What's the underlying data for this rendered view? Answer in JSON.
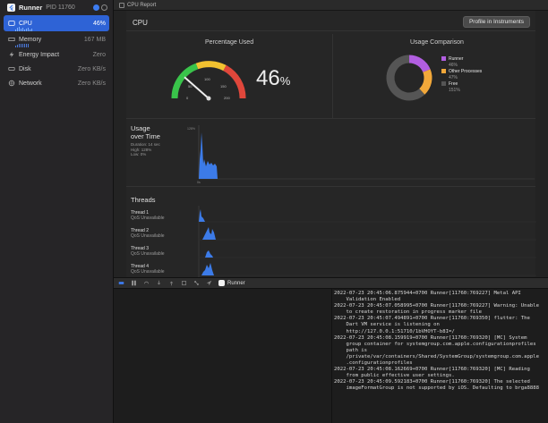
{
  "sidebar": {
    "app_name": "Runner",
    "pid": "PID 11760",
    "gauges": [
      {
        "label": "CPU",
        "value": "46%",
        "icon": "cpu-gauge-icon",
        "selected": true
      },
      {
        "label": "Memory",
        "value": "167 MB",
        "icon": "memory-gauge-icon"
      },
      {
        "label": "Energy Impact",
        "value": "Zero",
        "icon": "energy-icon"
      },
      {
        "label": "Disk",
        "value": "Zero KB/s",
        "icon": "disk-icon"
      },
      {
        "label": "Network",
        "value": "Zero KB/s",
        "icon": "network-icon"
      }
    ]
  },
  "main": {
    "window_title": "CPU Report",
    "cpu_label": "CPU",
    "profile_button": "Profile in Instruments",
    "percentage_used": {
      "title": "Percentage Used",
      "value": "46",
      "unit": "%",
      "gauge_ticks": [
        "0",
        "50",
        "100",
        "150",
        "200"
      ],
      "gauge_needle": 0.23
    },
    "usage_comparison": {
      "title": "Usage Comparison",
      "legend": [
        {
          "name": "Runner",
          "value": "46%",
          "color": "#b15ee0"
        },
        {
          "name": "Other Processes",
          "value": "47%",
          "color": "#f2a83a"
        },
        {
          "name": "Free",
          "value": "151%",
          "color": "#555555"
        }
      ]
    },
    "usage_over_time": {
      "title_line1": "Usage",
      "title_line2": "over Time",
      "duration": "Duration: 14 sec",
      "high": "High: 128%",
      "low": "Low: 0%",
      "y_max_label": "128%",
      "x_start_label": "0s"
    },
    "threads": {
      "title": "Threads",
      "items": [
        {
          "name": "Thread 1",
          "qos": "QoS Unavailable"
        },
        {
          "name": "Thread 2",
          "qos": "QoS Unavailable"
        },
        {
          "name": "Thread 3",
          "qos": "QoS Unavailable"
        },
        {
          "name": "Thread 4",
          "qos": "QoS Unavailable"
        }
      ]
    }
  },
  "debugbar": {
    "target": "Runner"
  },
  "console": {
    "lines": [
      "2022-07-23 20:45:06.875944+0700 Runner[11760:769227] Metal API",
      "    Validation Enabled",
      "2022-07-23 20:45:07.058995+0700 Runner[11760:769227] Warning: Unable",
      "    to create restoration in progress marker file",
      "2022-07-23 20:45:07.494891+0700 Runner[11760:769350] flutter: The",
      "    Dart VM service is listening on",
      "    http://127.0.0.1:51710/1bVHOYT-b8I=/",
      "2022-07-23 20:45:08.159919+0700 Runner[11760:769320] [MC] System",
      "    group container for systemgroup.com.apple.configurationprofiles",
      "    path is",
      "    /private/var/containers/Shared/SystemGroup/systemgroup.com.apple",
      "    .configurationprofiles",
      "2022-07-23 20:45:08.162669+0700 Runner[11760:769320] [MC] Reading",
      "    from public effective user settings.",
      "2022-07-23 20:45:09.592183+0700 Runner[11760:769320] The selected",
      "    imageFormatGroup is not supported by iOS. Defaulting to brga8888"
    ]
  }
}
